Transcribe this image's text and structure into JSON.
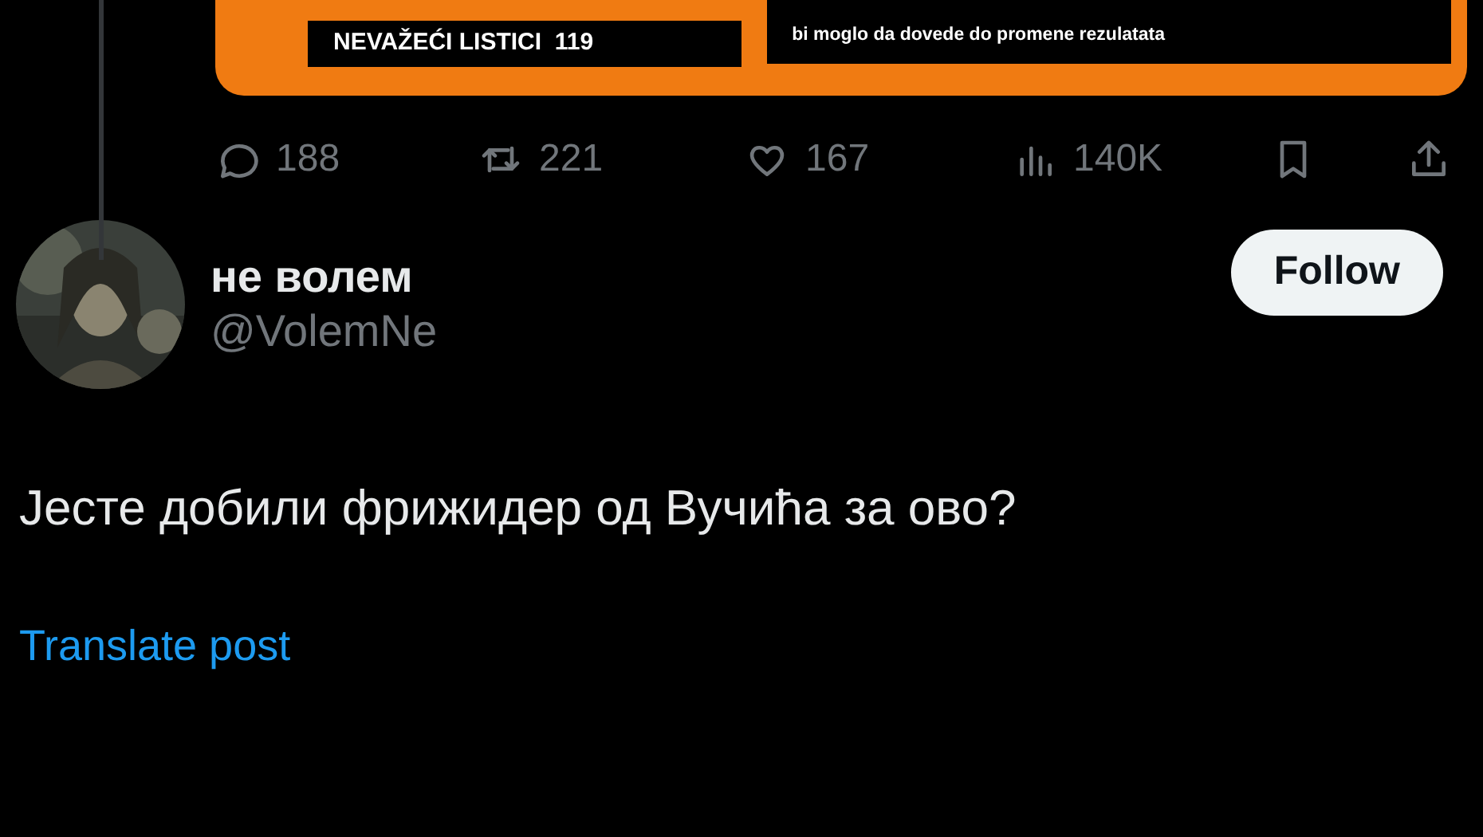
{
  "quoted_image": {
    "left_label": "NEVAŽEĆI LISTICI  119",
    "right_text": "bi moglo da dovede do promene rezulatata"
  },
  "actions": [
    {
      "kind": "reply",
      "count": "188"
    },
    {
      "kind": "repost",
      "count": "221"
    },
    {
      "kind": "like",
      "count": "167"
    },
    {
      "kind": "views",
      "count": "140K"
    },
    {
      "kind": "bookmark"
    },
    {
      "kind": "share"
    }
  ],
  "reply": {
    "display_name": "не волем",
    "handle": "@VolemNe",
    "follow_label": "Follow",
    "text": "Јесте добили фрижидер од Вучића за ово?",
    "translate_label": "Translate post"
  }
}
